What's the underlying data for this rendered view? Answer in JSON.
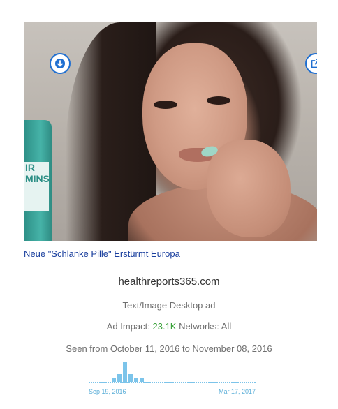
{
  "ad": {
    "headline": "Neue \"Schlanke Pille\" Erstürmt Europa",
    "domain": "healthreports365.com",
    "ad_type": "Text/Image Desktop ad",
    "impact_label": "Ad Impact:",
    "impact_value": "23.1K",
    "networks_label": "Networks: All",
    "seen_text": "Seen from October 11, 2016 to November 08, 2016",
    "image_bottle_text": "IR MINS"
  },
  "buttons": {
    "download_icon": "download-icon",
    "external_icon": "external-link-icon"
  },
  "timeline": {
    "start_label": "Sep 19, 2016",
    "end_label": "Mar 17, 2017",
    "bar_values": [
      0,
      0,
      0,
      0,
      1,
      2,
      5,
      2,
      1,
      1,
      0,
      0,
      0,
      0,
      0,
      0,
      0,
      0,
      0,
      0,
      0,
      0,
      0,
      0,
      0,
      0,
      0,
      0,
      0,
      0
    ],
    "color": "#7cc4ea"
  },
  "colors": {
    "accent": "#1f6fd1",
    "link": "#1a3f9e",
    "impact": "#3aa23a"
  }
}
